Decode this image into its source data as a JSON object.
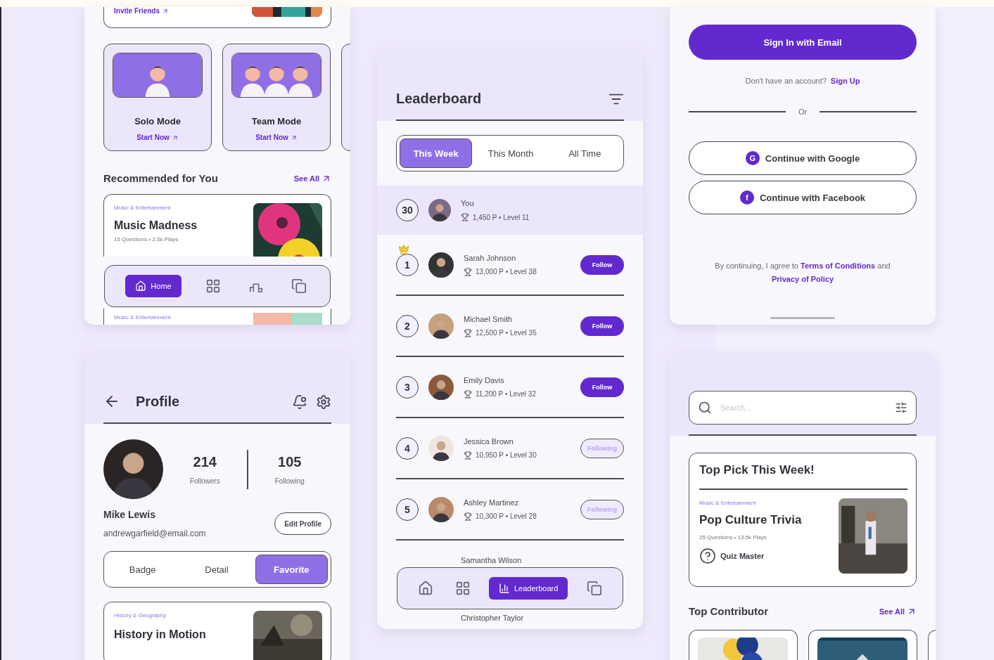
{
  "home_screen": {
    "invite_link": "Invite Friends",
    "modes": [
      {
        "kind": "solo",
        "title": "Solo Mode",
        "link": "Start Now"
      },
      {
        "kind": "team",
        "title": "Team Mode",
        "link": "Start Now"
      }
    ],
    "section": {
      "title": "Recommended for You",
      "see_all": "See All"
    },
    "quizzes": [
      {
        "category": "Music & Entertainment",
        "title": "Music Madness",
        "meta": "15 Questions • 2.5k Plays"
      },
      {
        "category": "Music & Entertainment"
      }
    ],
    "nav": [
      {
        "kind": "home",
        "label": "Home",
        "selected": true
      },
      {
        "kind": "grid",
        "selected": false
      },
      {
        "kind": "leaderboard",
        "selected": false
      },
      {
        "kind": "cards",
        "selected": false
      }
    ]
  },
  "leaderboard_screen": {
    "title": "Leaderboard",
    "tabs": [
      {
        "label": "This Week",
        "selected": true
      },
      {
        "label": "This Month",
        "selected": false
      },
      {
        "label": "All Time",
        "selected": false
      }
    ],
    "me": {
      "rank": "30",
      "name": "You",
      "meta": "1,450 P • Level 11"
    },
    "players": [
      {
        "rank": "1",
        "crown": true,
        "name": "Sarah Johnson",
        "meta": "13,000 P • Level 38",
        "following": false,
        "action": "Follow"
      },
      {
        "rank": "2",
        "crown": false,
        "name": "Michael Smith",
        "meta": "12,500 P • Level 35",
        "following": false,
        "action": "Follow"
      },
      {
        "rank": "3",
        "crown": false,
        "name": "Emily Davis",
        "meta": "11,200 P • Level 32",
        "following": false,
        "action": "Follow"
      },
      {
        "rank": "4",
        "crown": false,
        "name": "Jessica Brown",
        "meta": "10,950 P • Level 30",
        "following": true,
        "action": "Following"
      },
      {
        "rank": "5",
        "crown": false,
        "name": "Ashley Martinez",
        "meta": "10,300 P • Level 28",
        "following": true,
        "action": "Following"
      }
    ],
    "more_players": [
      "Samantha Wilson",
      "Christopher Taylor"
    ],
    "nav": [
      {
        "kind": "home",
        "selected": false
      },
      {
        "kind": "grid",
        "selected": false
      },
      {
        "kind": "leaderboard",
        "label": "Leaderboard",
        "selected": true
      },
      {
        "kind": "cards",
        "selected": false
      }
    ]
  },
  "signin_screen": {
    "email_button": "Sign In with Email",
    "no_account": "Don't have an account?",
    "sign_up": "Sign Up",
    "divider": "Or",
    "providers": [
      {
        "letter": "G",
        "label": "Continue with Google"
      },
      {
        "letter": "f",
        "label": "Continue with Facebook"
      }
    ],
    "terms": {
      "before": "By continuing, I agree to",
      "link1": "Terms of Conditions",
      "middle": "and",
      "link2": "Privacy of Policy"
    }
  },
  "profile_screen": {
    "title": "Profile",
    "followers": "214",
    "followers_label": "Followers",
    "following": "105",
    "following_label": "Following",
    "name": "Mike Lewis",
    "email": "andrewgarfield@email.com",
    "edit_button": "Edit Profile",
    "tabs": [
      {
        "label": "Badge",
        "selected": false
      },
      {
        "label": "Detail",
        "selected": false
      },
      {
        "label": "Favorite",
        "selected": true
      }
    ],
    "card": {
      "category": "History & Geography",
      "title": "History in Motion"
    }
  },
  "search_screen": {
    "search": {
      "placeholder": "Search..."
    },
    "top_pick": {
      "heading": "Top Pick This Week!",
      "category": "Music & Entertainment",
      "title": "Pop Culture Trivia",
      "meta": "25 Questions • 13.5k Plays",
      "author": "Quiz Master"
    },
    "section": {
      "title": "Top Contributor",
      "see_all": "See All"
    }
  }
}
